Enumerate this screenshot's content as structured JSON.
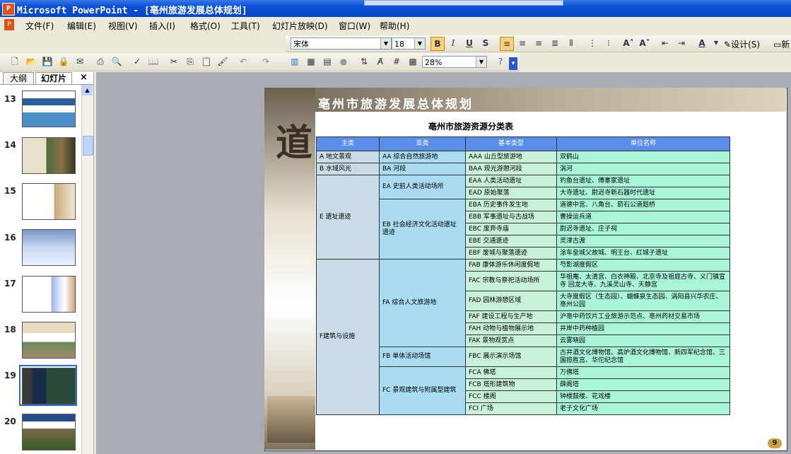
{
  "window": {
    "title": "Microsoft PowerPoint - [亳州旅游发展总体规划]"
  },
  "menu": [
    "文件(F)",
    "编辑(E)",
    "视图(V)",
    "插入(I)",
    "格式(O)",
    "工具(T)",
    "幻灯片放映(D)",
    "窗口(W)",
    "帮助(H)"
  ],
  "format_toolbar": {
    "font": "宋体",
    "size": "18",
    "bold": "B",
    "italic": "I",
    "underline": "U",
    "shadow": "S",
    "design_label": "设计(S)",
    "new_label": "新"
  },
  "standard_toolbar": {
    "zoom": "28%"
  },
  "pane": {
    "tab_outline": "大纲",
    "tab_slides": "幻灯片",
    "close": "×",
    "slide_numbers": [
      "13",
      "14",
      "15",
      "16",
      "17",
      "18",
      "19",
      "20"
    ],
    "selected": "19"
  },
  "slide": {
    "header_title": "亳州市旅游发展总体规划",
    "table_title": "亳州市旅游资源分类表",
    "page_number": "9",
    "columns": [
      "主类",
      "亚类",
      "基本类型",
      "单位名称"
    ],
    "cells": {
      "A": "A 地文景观",
      "AA": "AA 综合自然旅游地",
      "AAA": "AAA 山丘型旅游地",
      "AAA_u": "双鹤山",
      "B": "B 水域风光",
      "BA": "BA 河段",
      "BAA": "BAA 观光游憩河段",
      "BAA_u": "涡河",
      "E": "E 遗址遗迹",
      "EA": "EA 史前人类活动场所",
      "EAA": "EAA 人类活动遗址",
      "EAA_u": "钓鱼台遗址、傅寨家遗址",
      "EAD": "EAD 原始聚落",
      "EAD_u": "大寺遗址、尉迟寺新石器时代遗址",
      "EB": "EB 社会经济文化活动遗址遗迹",
      "EBA": "EBA 历史事件发生地",
      "EBA_u": "道德中宫、八角台、箭石公道题桥",
      "EBB": "EBB 军事遗址与古战场",
      "EBB_u": "曹操运兵道",
      "EBC": "EBC 废弃寺庙",
      "EBC_u": "尉迟寺遗址、庄子祠",
      "EBE": "EBE 交通遗迹",
      "EBE_u": "灵津古渡",
      "EBF": "EBF 废城与聚落遗迹",
      "EBF_u": "涂车垒城父故城、明王台、红城子遗址",
      "F": "F建筑与设施",
      "FA": "FA 综合人文旅游地",
      "FAB": "FAB 康体游乐休闲度假地",
      "FAB_u": "芍影湖度假区",
      "FAC": "FAC 宗教与祭祀活动场所",
      "FAC_u": "华祖庵、太清宫、白衣神殿、北京寺及祖庭古寺、义门镇宣寺 回龙大寺、九溪灵山寺、天静宫",
      "FAD": "FAD 园林游憩区域",
      "FAD_u": "大寺度假区（生态园）、蝴蝶泉生态园、涡阳县兴华农庄、亳州公园",
      "FAF": "FAF 建设工程与生产地",
      "FAF_u": "沪亳中药饮片工业旅游示范点、亳州药材交易市场",
      "FAH": "FAH 动物与植物展示地",
      "FAH_u": "井岸中药种植园",
      "FAK": "FAK 景物观赏点",
      "FAK_u": "云雾晓园",
      "FB": "FB 单体活动场馆",
      "FBC": "FBC 展示演示场馆",
      "FBC_u": "古井酒文化博物馆、高炉酒文化博物馆、新四军纪念馆、三国揽胜宫、华佗纪念馆",
      "FC": "FC 景观建筑与附属型建筑",
      "FCA": "FCA 佛塔",
      "FCA_u": "万佛塔",
      "FCB": "FCB 塔形建筑物",
      "FCB_u": "薛阁塔",
      "FCC": "FCC 楼阁",
      "FCC_u": "钟楼鼓楼、花戏楼",
      "FCI": "FCI 广场",
      "FCI_u": "老子文化广场"
    }
  }
}
